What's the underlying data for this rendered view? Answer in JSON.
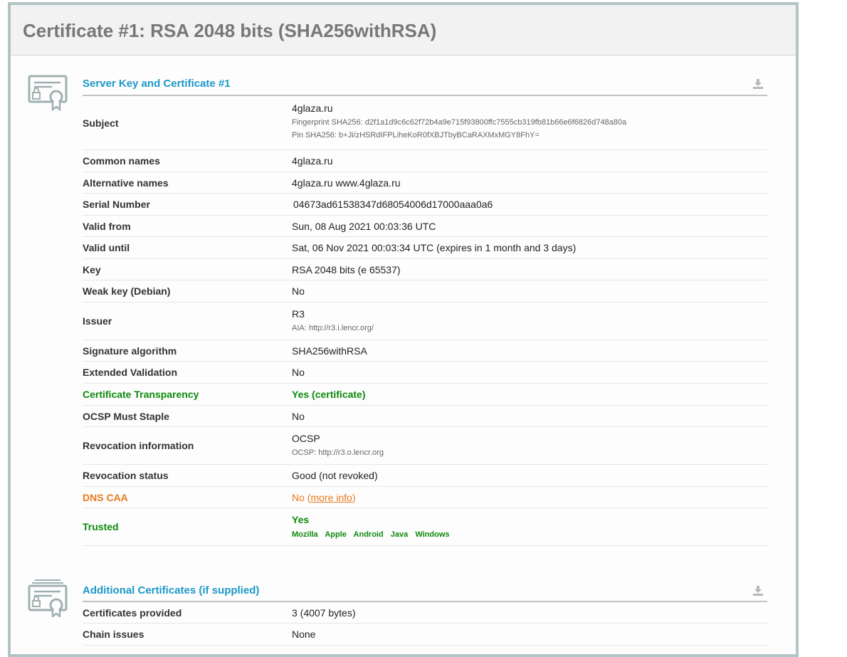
{
  "page_title": "Certificate #1: RSA 2048 bits (SHA256withRSA)",
  "server_section": {
    "title": "Server Key and Certificate #1",
    "icon": "certificate-icon",
    "download_icon": "download-icon",
    "subject": {
      "label": "Subject",
      "value": "4glaza.ru",
      "fingerprint": "Fingerprint SHA256: d2f1a1d9c6c62f72b4a9e715f93800ffc7555cb319fb81b66e6f6826d748a80a",
      "pin": "Pin SHA256: b+Ji/zHSRdIFPLiheKoR0fXBJTbyBCaRAXMxMGY8FhY="
    },
    "common_names": {
      "label": "Common names",
      "value": "4glaza.ru"
    },
    "alternative_names": {
      "label": "Alternative names",
      "value": "4glaza.ru www.4glaza.ru"
    },
    "serial_number": {
      "label": "Serial Number",
      "value": "04673ad61538347d68054006d17000aaa0a6"
    },
    "valid_from": {
      "label": "Valid from",
      "value": "Sun, 08 Aug 2021 00:03:36 UTC"
    },
    "valid_until": {
      "label": "Valid until",
      "value": "Sat, 06 Nov 2021 00:03:34 UTC (expires in 1 month and 3 days)"
    },
    "key": {
      "label": "Key",
      "value": "RSA 2048 bits (e 65537)"
    },
    "weak_key": {
      "label": "Weak key (Debian)",
      "value": "No"
    },
    "issuer": {
      "label": "Issuer",
      "value": "R3",
      "aia": "AIA: http://r3.i.lencr.org/"
    },
    "signature_algorithm": {
      "label": "Signature algorithm",
      "value": "SHA256withRSA"
    },
    "extended_validation": {
      "label": "Extended Validation",
      "value": "No"
    },
    "certificate_transparency": {
      "label": "Certificate Transparency",
      "value": "Yes (certificate)"
    },
    "ocsp_must_staple": {
      "label": "OCSP Must Staple",
      "value": "No"
    },
    "revocation_information": {
      "label": "Revocation information",
      "value": "OCSP",
      "ocsp": "OCSP: http://r3.o.lencr.org"
    },
    "revocation_status": {
      "label": "Revocation status",
      "value": "Good (not revoked)"
    },
    "dns_caa": {
      "label": "DNS CAA",
      "value": "No",
      "more_info_open": "(",
      "more_info": "more info",
      "more_info_close": ")"
    },
    "trusted": {
      "label": "Trusted",
      "value": "Yes",
      "platforms": [
        "Mozilla",
        "Apple",
        "Android",
        "Java",
        "Windows"
      ]
    }
  },
  "additional_section": {
    "title": "Additional Certificates (if supplied)",
    "icon": "certificates-stack-icon",
    "download_icon": "download-icon",
    "certificates_provided": {
      "label": "Certificates provided",
      "value": "3 (4007 bytes)"
    },
    "chain_issues": {
      "label": "Chain issues",
      "value": "None"
    }
  },
  "colors": {
    "accent_blue": "#1b98c8",
    "success_green": "#0c8a0c",
    "warning_orange": "#e8791a",
    "frame_border": "#b2c5c5"
  }
}
